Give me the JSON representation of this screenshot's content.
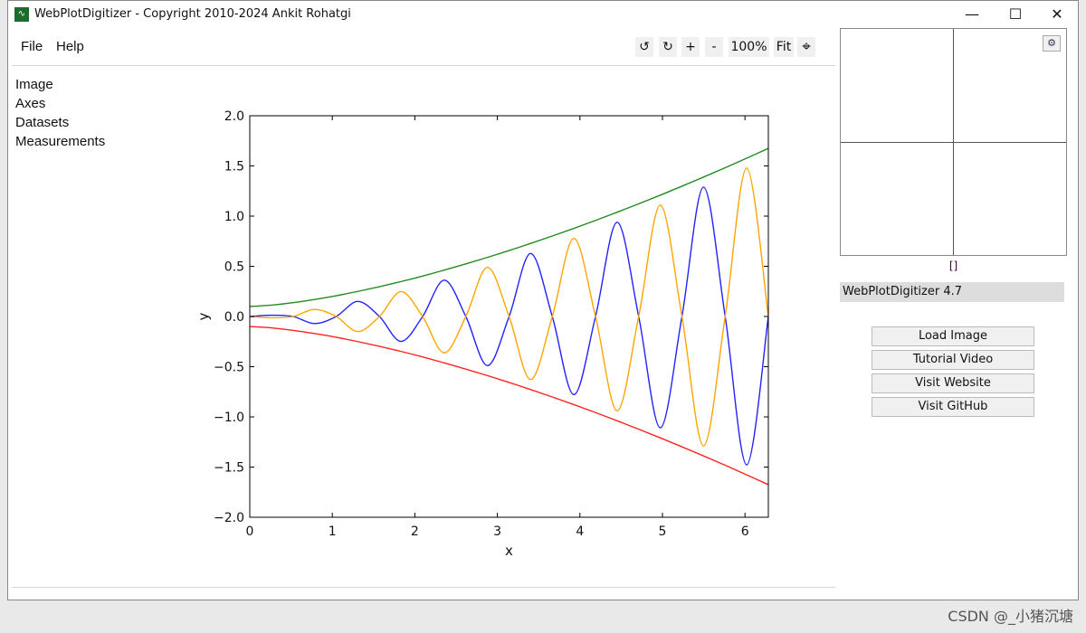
{
  "window": {
    "title": "WebPlotDigitizer - Copyright 2010-2024 Ankit Rohatgi",
    "icon": "wpd-logo-icon",
    "controls": {
      "minimize": "—",
      "maximize": "☐",
      "close": "✕"
    }
  },
  "menu": [
    {
      "label": "File"
    },
    {
      "label": "Help"
    }
  ],
  "toolbar": {
    "rotate_left": "↺",
    "rotate_right": "↻",
    "zoom_in": "+",
    "zoom_out": "-",
    "zoom_level": "100%",
    "fit": "Fit",
    "crosshair": "⌖"
  },
  "sidebar": [
    {
      "label": "Image"
    },
    {
      "label": "Axes"
    },
    {
      "label": "Datasets"
    },
    {
      "label": "Measurements"
    }
  ],
  "right_panel": {
    "zoom_settings_icon": "gear-icon",
    "cursor_coords": "[]",
    "version": "WebPlotDigitizer 4.7",
    "buttons": [
      {
        "label": "Load Image"
      },
      {
        "label": "Tutorial Video"
      },
      {
        "label": "Visit Website"
      },
      {
        "label": "Visit GitHub"
      }
    ]
  },
  "watermark": "CSDN @_小猪沉塘",
  "chart_data": {
    "type": "line",
    "title": "",
    "xlabel": "x",
    "ylabel": "y",
    "xlim": [
      0,
      6.283
    ],
    "ylim": [
      -2.0,
      2.0
    ],
    "xticks": [
      "0",
      "1",
      "2",
      "3",
      "4",
      "5",
      "6"
    ],
    "yticks": [
      "−2.0",
      "−1.5",
      "−1.0",
      "−0.5",
      "0.0",
      "0.5",
      "1.0",
      "1.5",
      "2.0"
    ],
    "grid": false,
    "legend": "none",
    "x": [
      0,
      0.262,
      0.524,
      0.785,
      1.047,
      1.309,
      1.571,
      1.833,
      2.094,
      2.356,
      2.618,
      2.88,
      3.142,
      3.403,
      3.665,
      3.927,
      4.189,
      4.451,
      4.712,
      4.974,
      5.236,
      5.498,
      5.76,
      6.021,
      6.283
    ],
    "series": [
      {
        "color": "#2222ff",
        "values": [
          0,
          0.013,
          0,
          -0.07,
          0,
          0.15,
          0,
          -0.248,
          0,
          0.362,
          0,
          -0.489,
          0,
          0.628,
          0,
          -0.778,
          0,
          0.939,
          0,
          -1.109,
          0,
          1.289,
          0,
          -1.478,
          0
        ]
      },
      {
        "color": "#ffa500",
        "values": [
          0,
          -0.013,
          0,
          0.07,
          0,
          -0.15,
          0,
          0.248,
          0,
          -0.362,
          0,
          0.489,
          0,
          -0.628,
          0,
          0.778,
          0,
          -0.939,
          0,
          1.109,
          0,
          -1.289,
          0,
          1.478,
          0
        ]
      },
      {
        "color": "#228b22",
        "values": [
          0.1,
          0.113,
          0.138,
          0.17,
          0.207,
          0.25,
          0.297,
          0.348,
          0.403,
          0.462,
          0.524,
          0.589,
          0.657,
          0.728,
          0.802,
          0.878,
          0.957,
          1.039,
          1.123,
          1.209,
          1.298,
          1.389,
          1.482,
          1.578,
          1.675
        ]
      },
      {
        "color": "#ff2222",
        "values": [
          -0.1,
          -0.113,
          -0.138,
          -0.17,
          -0.207,
          -0.25,
          -0.297,
          -0.348,
          -0.403,
          -0.462,
          -0.524,
          -0.589,
          -0.657,
          -0.728,
          -0.802,
          -0.878,
          -0.957,
          -1.039,
          -1.123,
          -1.209,
          -1.298,
          -1.389,
          -1.482,
          -1.578,
          -1.675
        ]
      }
    ]
  }
}
